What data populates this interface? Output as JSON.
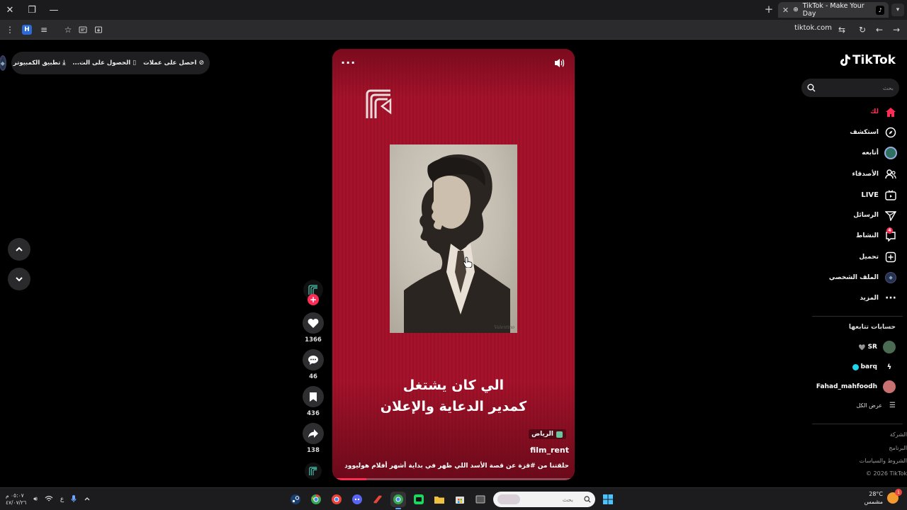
{
  "browser": {
    "tab_title": "TikTok - Make Your Day",
    "url": "tiktok.com",
    "extension_label": "H"
  },
  "promo": {
    "get_coins": "احصل على عملات",
    "get_app": "الحصول على الت...",
    "desktop_app": "تطبيق الكمبيوتر"
  },
  "video": {
    "caption_line1": "الي كان يشتغل",
    "caption_line2": "كمدير الدعاية والإعلان",
    "location": "الرياض",
    "author": "film_rent",
    "description": "حلقتنا من #قزة عن قصة الأسد اللي ظهر في بداية أشهر أفلام هوليوود",
    "photo_signature": "Valentino",
    "progress": 0.14,
    "accent_color": "#a4132b"
  },
  "actions": {
    "likes": "1366",
    "comments": "46",
    "saves": "436",
    "shares": "138"
  },
  "sidebar": {
    "brand": "TikTok",
    "search_placeholder": "بحث",
    "nav": {
      "home": "لك",
      "explore": "استكشف",
      "following": "أتابعه",
      "friends": "الأصدقاء",
      "live": "LIVE",
      "messages": "الرسائل",
      "activity": "النشاط",
      "activity_badge": "4",
      "upload": "تحميل",
      "profile": "الملف الشخصي",
      "more": "المزيد"
    },
    "following_title": "حسابات تتابعها",
    "following": [
      {
        "name": "SR",
        "suffix": "🩶"
      },
      {
        "name": "barq",
        "suffix": ""
      },
      {
        "name": "Fahad_mahfoodh",
        "suffix": ""
      }
    ],
    "see_all": "عرض الكل",
    "footer": {
      "company": "الشركة",
      "program": "البرنامج",
      "terms": "الشروط والسياسات",
      "copyright": "© 2026 TikTok"
    },
    "brand_color": "#fe2c55"
  },
  "taskbar": {
    "time": "٠٥:٠٧ م",
    "date": "٤٧/٠٧/٢٦",
    "lang": "ع",
    "search_placeholder": "بحث",
    "weather_temp": "28°C",
    "weather_desc": "مشمس",
    "weather_badge": "1"
  }
}
